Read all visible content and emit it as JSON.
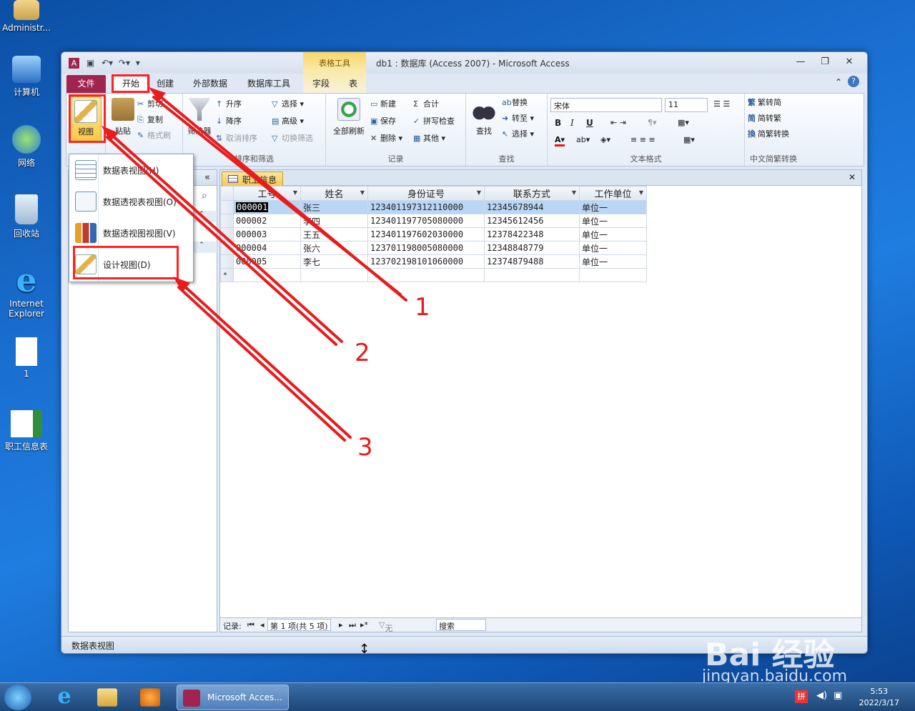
{
  "desktop": {
    "icons": [
      {
        "label": "Administr..."
      },
      {
        "label": "计算机"
      },
      {
        "label": "网络"
      },
      {
        "label": "回收站"
      },
      {
        "label": "Internet Explorer"
      },
      {
        "label": "1"
      },
      {
        "label": "职工信息表"
      }
    ]
  },
  "window": {
    "title": "db1 : 数据库 (Access 2007)  -  Microsoft Access",
    "context_tab_group": "表格工具",
    "app_icon_letter": "A"
  },
  "tabs": {
    "file": "文件",
    "home": "开始",
    "create": "创建",
    "external": "外部数据",
    "dbtools": "数据库工具",
    "fields": "字段",
    "table": "表"
  },
  "ribbon": {
    "view": {
      "label": "视图"
    },
    "clipboard": {
      "paste": "粘贴",
      "cut": "剪切",
      "copy": "复制",
      "format_painter": "格式刷"
    },
    "sort_filter": {
      "filter": "筛选器",
      "ascending": "升序",
      "descending": "降序",
      "clear_sort": "取消排序",
      "selection": "选择 ▾",
      "advanced": "高级 ▾",
      "toggle_filter": "切换筛选",
      "label": "排序和筛选"
    },
    "records": {
      "refresh_all": "全部刷新",
      "new": "新建",
      "save": "保存",
      "delete": "删除 ▾",
      "totals": "合计",
      "spelling": "拼写检查",
      "more": "其他 ▾",
      "label": "记录"
    },
    "find": {
      "find": "查找",
      "replace": "替换",
      "goto": "转至 ▾",
      "select": "选择 ▾",
      "label": "查找"
    },
    "text_format": {
      "font": "宋体",
      "size": "11",
      "bold": "B",
      "italic": "I",
      "underline": "U",
      "label": "文本格式"
    },
    "chinese": {
      "t2s": "繁转简",
      "s2t": "简转繁",
      "convert": "简繁转换",
      "label": "中文简繁转换"
    }
  },
  "view_menu": {
    "items": [
      {
        "label": "数据表视图(H)"
      },
      {
        "label": "数据透视表视图(O)"
      },
      {
        "label": "数据透视图视图(V)"
      },
      {
        "label": "设计视图(D)"
      }
    ]
  },
  "document": {
    "tab_label": "职工信息",
    "columns": [
      "工号",
      "姓名",
      "身份证号",
      "联系方式",
      "工作单位"
    ],
    "rows": [
      [
        "000001",
        "张三",
        "123401197312110000",
        "12345678944",
        "单位一"
      ],
      [
        "000002",
        "李四",
        "123401197705080000",
        "12345612456",
        "单位一"
      ],
      [
        "000003",
        "王五",
        "123401197602030000",
        "12378422348",
        "单位一"
      ],
      [
        "000004",
        "张六",
        "123701198005080000",
        "12348848779",
        "单位一"
      ],
      [
        "000005",
        "李七",
        "123702198101060000",
        "12374879488",
        "单位一"
      ]
    ],
    "new_row_marker": "*",
    "record_bar": {
      "label": "记录:",
      "position": "第 1 项(共 5 项)",
      "no_filter": "无筛选器",
      "search": "搜索"
    }
  },
  "status": {
    "left": "数据表视图"
  },
  "annotations": {
    "n1": "1",
    "n2": "2",
    "n3": "3"
  },
  "taskbar": {
    "access_label": "Microsoft Acces...",
    "ime": "拼",
    "time": "5:53",
    "date": "2022/3/17"
  },
  "watermark": {
    "brand": "Bai 经验",
    "url": "jingyan.baidu.com"
  },
  "colors": {
    "file_tab": "#a1244e",
    "highlight": "#ff2222",
    "context_tab": "#f7d66c",
    "selected_row": "#b9d6f5"
  }
}
